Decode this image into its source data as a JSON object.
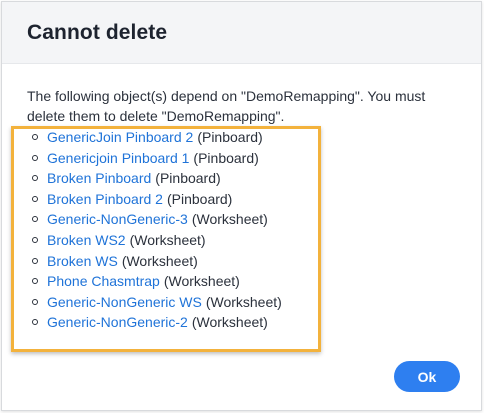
{
  "dialog": {
    "title": "Cannot delete",
    "message": "The following object(s) depend on \"DemoRemapping\". You must delete them to delete \"DemoRemapping\".",
    "dependencies": [
      {
        "name": "GenericJoin Pinboard 2",
        "type": "(Pinboard)"
      },
      {
        "name": "Genericjoin Pinboard 1",
        "type": "(Pinboard)"
      },
      {
        "name": "Broken Pinboard",
        "type": "(Pinboard)"
      },
      {
        "name": "Broken Pinboard 2",
        "type": "(Pinboard)"
      },
      {
        "name": "Generic-NonGeneric-3",
        "type": "(Worksheet)"
      },
      {
        "name": "Broken WS2",
        "type": "(Worksheet)"
      },
      {
        "name": "Broken WS",
        "type": "(Worksheet)"
      },
      {
        "name": "Phone Chasmtrap",
        "type": "(Worksheet)"
      },
      {
        "name": "Generic-NonGeneric WS",
        "type": "(Worksheet)"
      },
      {
        "name": "Generic-NonGeneric-2",
        "type": "(Worksheet)"
      }
    ],
    "ok_label": "Ok"
  },
  "colors": {
    "link": "#1f73d8",
    "primary_button": "#2e7ff0",
    "highlight": "#f3b23c"
  }
}
